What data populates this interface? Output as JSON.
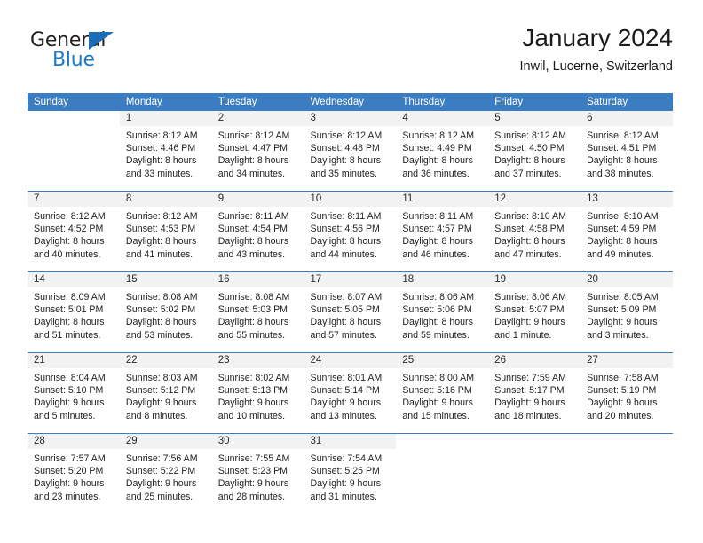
{
  "brand": {
    "name_dark": "General",
    "name_blue": "Blue",
    "color_dark": "#231f20",
    "color_blue": "#1b7bc4"
  },
  "header": {
    "title": "January 2024",
    "subtitle": "Inwil, Lucerne, Switzerland",
    "accent_color": "#3b7dc0",
    "band_color": "#f2f2f2"
  },
  "calendar": {
    "weekday_headers": [
      "Sunday",
      "Monday",
      "Tuesday",
      "Wednesday",
      "Thursday",
      "Friday",
      "Saturday"
    ],
    "weeks": [
      [
        {
          "day": "",
          "blank": true,
          "lines": []
        },
        {
          "day": "1",
          "lines": [
            "Sunrise: 8:12 AM",
            "Sunset: 4:46 PM",
            "Daylight: 8 hours",
            "and 33 minutes."
          ]
        },
        {
          "day": "2",
          "lines": [
            "Sunrise: 8:12 AM",
            "Sunset: 4:47 PM",
            "Daylight: 8 hours",
            "and 34 minutes."
          ]
        },
        {
          "day": "3",
          "lines": [
            "Sunrise: 8:12 AM",
            "Sunset: 4:48 PM",
            "Daylight: 8 hours",
            "and 35 minutes."
          ]
        },
        {
          "day": "4",
          "lines": [
            "Sunrise: 8:12 AM",
            "Sunset: 4:49 PM",
            "Daylight: 8 hours",
            "and 36 minutes."
          ]
        },
        {
          "day": "5",
          "lines": [
            "Sunrise: 8:12 AM",
            "Sunset: 4:50 PM",
            "Daylight: 8 hours",
            "and 37 minutes."
          ]
        },
        {
          "day": "6",
          "lines": [
            "Sunrise: 8:12 AM",
            "Sunset: 4:51 PM",
            "Daylight: 8 hours",
            "and 38 minutes."
          ]
        }
      ],
      [
        {
          "day": "7",
          "lines": [
            "Sunrise: 8:12 AM",
            "Sunset: 4:52 PM",
            "Daylight: 8 hours",
            "and 40 minutes."
          ]
        },
        {
          "day": "8",
          "lines": [
            "Sunrise: 8:12 AM",
            "Sunset: 4:53 PM",
            "Daylight: 8 hours",
            "and 41 minutes."
          ]
        },
        {
          "day": "9",
          "lines": [
            "Sunrise: 8:11 AM",
            "Sunset: 4:54 PM",
            "Daylight: 8 hours",
            "and 43 minutes."
          ]
        },
        {
          "day": "10",
          "lines": [
            "Sunrise: 8:11 AM",
            "Sunset: 4:56 PM",
            "Daylight: 8 hours",
            "and 44 minutes."
          ]
        },
        {
          "day": "11",
          "lines": [
            "Sunrise: 8:11 AM",
            "Sunset: 4:57 PM",
            "Daylight: 8 hours",
            "and 46 minutes."
          ]
        },
        {
          "day": "12",
          "lines": [
            "Sunrise: 8:10 AM",
            "Sunset: 4:58 PM",
            "Daylight: 8 hours",
            "and 47 minutes."
          ]
        },
        {
          "day": "13",
          "lines": [
            "Sunrise: 8:10 AM",
            "Sunset: 4:59 PM",
            "Daylight: 8 hours",
            "and 49 minutes."
          ]
        }
      ],
      [
        {
          "day": "14",
          "lines": [
            "Sunrise: 8:09 AM",
            "Sunset: 5:01 PM",
            "Daylight: 8 hours",
            "and 51 minutes."
          ]
        },
        {
          "day": "15",
          "lines": [
            "Sunrise: 8:08 AM",
            "Sunset: 5:02 PM",
            "Daylight: 8 hours",
            "and 53 minutes."
          ]
        },
        {
          "day": "16",
          "lines": [
            "Sunrise: 8:08 AM",
            "Sunset: 5:03 PM",
            "Daylight: 8 hours",
            "and 55 minutes."
          ]
        },
        {
          "day": "17",
          "lines": [
            "Sunrise: 8:07 AM",
            "Sunset: 5:05 PM",
            "Daylight: 8 hours",
            "and 57 minutes."
          ]
        },
        {
          "day": "18",
          "lines": [
            "Sunrise: 8:06 AM",
            "Sunset: 5:06 PM",
            "Daylight: 8 hours",
            "and 59 minutes."
          ]
        },
        {
          "day": "19",
          "lines": [
            "Sunrise: 8:06 AM",
            "Sunset: 5:07 PM",
            "Daylight: 9 hours",
            "and 1 minute."
          ]
        },
        {
          "day": "20",
          "lines": [
            "Sunrise: 8:05 AM",
            "Sunset: 5:09 PM",
            "Daylight: 9 hours",
            "and 3 minutes."
          ]
        }
      ],
      [
        {
          "day": "21",
          "lines": [
            "Sunrise: 8:04 AM",
            "Sunset: 5:10 PM",
            "Daylight: 9 hours",
            "and 5 minutes."
          ]
        },
        {
          "day": "22",
          "lines": [
            "Sunrise: 8:03 AM",
            "Sunset: 5:12 PM",
            "Daylight: 9 hours",
            "and 8 minutes."
          ]
        },
        {
          "day": "23",
          "lines": [
            "Sunrise: 8:02 AM",
            "Sunset: 5:13 PM",
            "Daylight: 9 hours",
            "and 10 minutes."
          ]
        },
        {
          "day": "24",
          "lines": [
            "Sunrise: 8:01 AM",
            "Sunset: 5:14 PM",
            "Daylight: 9 hours",
            "and 13 minutes."
          ]
        },
        {
          "day": "25",
          "lines": [
            "Sunrise: 8:00 AM",
            "Sunset: 5:16 PM",
            "Daylight: 9 hours",
            "and 15 minutes."
          ]
        },
        {
          "day": "26",
          "lines": [
            "Sunrise: 7:59 AM",
            "Sunset: 5:17 PM",
            "Daylight: 9 hours",
            "and 18 minutes."
          ]
        },
        {
          "day": "27",
          "lines": [
            "Sunrise: 7:58 AM",
            "Sunset: 5:19 PM",
            "Daylight: 9 hours",
            "and 20 minutes."
          ]
        }
      ],
      [
        {
          "day": "28",
          "lines": [
            "Sunrise: 7:57 AM",
            "Sunset: 5:20 PM",
            "Daylight: 9 hours",
            "and 23 minutes."
          ]
        },
        {
          "day": "29",
          "lines": [
            "Sunrise: 7:56 AM",
            "Sunset: 5:22 PM",
            "Daylight: 9 hours",
            "and 25 minutes."
          ]
        },
        {
          "day": "30",
          "lines": [
            "Sunrise: 7:55 AM",
            "Sunset: 5:23 PM",
            "Daylight: 9 hours",
            "and 28 minutes."
          ]
        },
        {
          "day": "31",
          "lines": [
            "Sunrise: 7:54 AM",
            "Sunset: 5:25 PM",
            "Daylight: 9 hours",
            "and 31 minutes."
          ]
        },
        {
          "day": "",
          "blank": true,
          "lines": []
        },
        {
          "day": "",
          "blank": true,
          "lines": []
        },
        {
          "day": "",
          "blank": true,
          "lines": []
        }
      ]
    ]
  }
}
